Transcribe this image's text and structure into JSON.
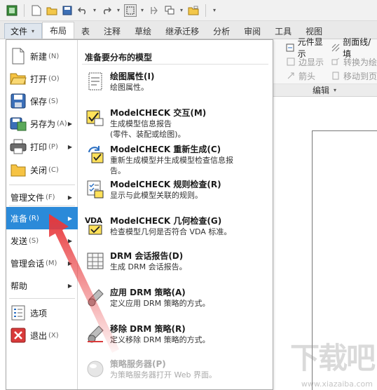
{
  "tabs": {
    "file": "文件",
    "items": [
      "布局",
      "表",
      "注释",
      "草绘",
      "继承迁移",
      "分析",
      "审阅",
      "工具",
      "视图"
    ]
  },
  "ribbon": {
    "row1_a": "元件显示",
    "row1_b": "剖面线/填",
    "row2_a": "边显示",
    "row2_b": "转换为绘",
    "row3_a": "箭头",
    "row3_b": "移动到页",
    "group": "编辑"
  },
  "menu": {
    "items": [
      {
        "label": "新建",
        "key": "(N)"
      },
      {
        "label": "打开",
        "key": "(O)"
      },
      {
        "label": "保存",
        "key": "(S)"
      },
      {
        "label": "另存为",
        "key": "(A)"
      },
      {
        "label": "打印",
        "key": "(P)"
      },
      {
        "label": "关闭",
        "key": "(C)"
      },
      {
        "label": "管理文件",
        "key": "(F)"
      },
      {
        "label": "准备",
        "key": "(R)"
      },
      {
        "label": "发送",
        "key": "(S)"
      },
      {
        "label": "管理会话",
        "key": "(M)"
      },
      {
        "label": "帮助",
        "key": ""
      },
      {
        "label": "选项",
        "key": ""
      },
      {
        "label": "退出",
        "key": "(X)"
      }
    ]
  },
  "submenu": {
    "header": "准备要分布的模型",
    "items": [
      {
        "title": "绘图属性(I)",
        "desc1": "绘图属性。",
        "desc2": ""
      },
      {
        "title": "ModelCHECK 交互(M)",
        "desc1": "生成模型信息报告",
        "desc2": "(零件、装配或绘图)。"
      },
      {
        "title": "ModelCHECK 重新生成(C)",
        "desc1": "重新生成模型并生成模型检查信息报",
        "desc2": "告。"
      },
      {
        "title": "ModelCHECK 规则检查(R)",
        "desc1": "显示与此模型关联的规则。",
        "desc2": ""
      },
      {
        "title": "ModelCHECK 几何检查(G)",
        "desc1": "检查模型几何是否符合 VDA 标准。",
        "desc2": ""
      },
      {
        "title": "DRM 会话报告(D)",
        "desc1": "生成 DRM 会话报告。",
        "desc2": ""
      },
      {
        "title": "应用 DRM 策略(A)",
        "desc1": "定义应用 DRM 策略的方式。",
        "desc2": ""
      },
      {
        "title": "移除 DRM 策略(R)",
        "desc1": "定义移除 DRM 策略的方式。",
        "desc2": ""
      },
      {
        "title": "策略服务器(P)",
        "desc1": "为策略服务器打开 Web 界面。",
        "desc2": ""
      }
    ],
    "vda_label": "VDA"
  },
  "watermark": {
    "cn": "下载吧",
    "url": "www.xiazaiba.com"
  },
  "colors": {
    "highlight": "#2b8ad9",
    "arrow": "#e8383b"
  }
}
